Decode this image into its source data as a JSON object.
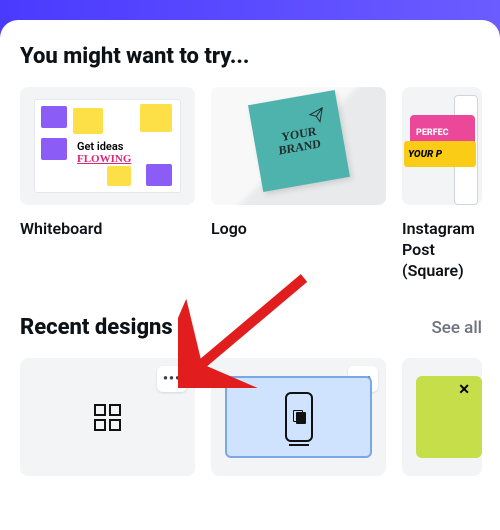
{
  "header": {
    "try_title": "You might want to try...",
    "recent_title": "Recent designs",
    "see_all": "See all"
  },
  "try_items": [
    {
      "label": "Whiteboard",
      "wb_line1": "Get ideas",
      "wb_line2": "FLOWING"
    },
    {
      "label": "Logo",
      "logo_line1": "YOUR",
      "logo_line2": "BRAND"
    },
    {
      "label": "Instagram Post (Square)",
      "ig_pink": "PERFEC",
      "ig_yellow": "YOUR P"
    }
  ],
  "recent": [
    {
      "menu": "•••",
      "kind": "template-grid"
    },
    {
      "menu": "•••",
      "kind": "phone-mock"
    },
    {
      "menu": "",
      "kind": "lime",
      "x": "✕"
    }
  ]
}
